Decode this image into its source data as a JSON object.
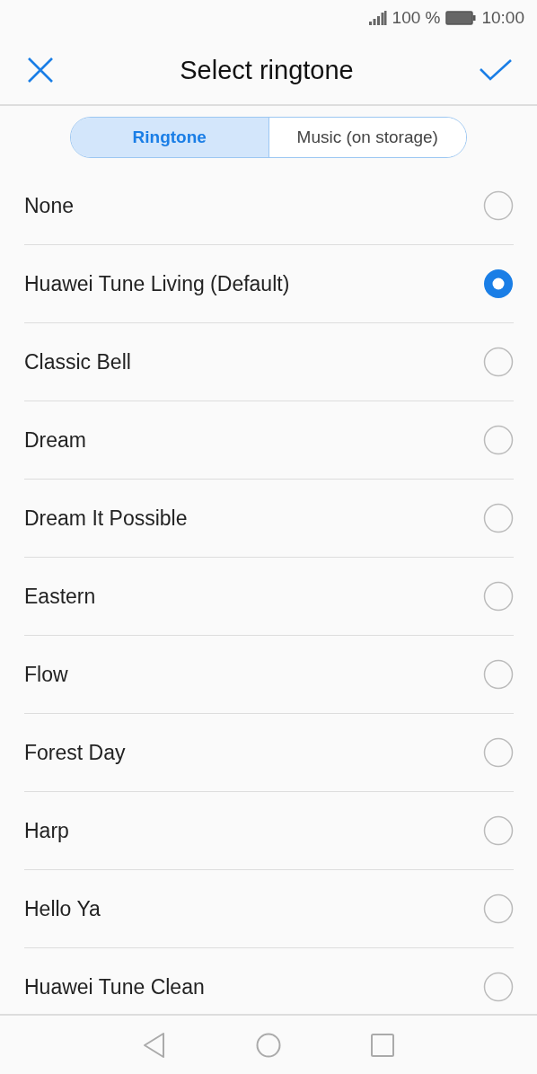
{
  "status_bar": {
    "battery": "100 %",
    "time": "10:00"
  },
  "header": {
    "title": "Select ringtone"
  },
  "tabs": [
    {
      "label": "Ringtone",
      "selected": true
    },
    {
      "label": "Music (on storage)",
      "selected": false
    }
  ],
  "ringtones": [
    {
      "name": "None",
      "selected": false
    },
    {
      "name": "Huawei Tune Living (Default)",
      "selected": true
    },
    {
      "name": "Classic Bell",
      "selected": false
    },
    {
      "name": "Dream",
      "selected": false
    },
    {
      "name": "Dream It Possible",
      "selected": false
    },
    {
      "name": "Eastern",
      "selected": false
    },
    {
      "name": "Flow",
      "selected": false
    },
    {
      "name": "Forest Day",
      "selected": false
    },
    {
      "name": "Harp",
      "selected": false
    },
    {
      "name": "Hello Ya",
      "selected": false
    },
    {
      "name": "Huawei Tune Clean",
      "selected": false
    }
  ]
}
